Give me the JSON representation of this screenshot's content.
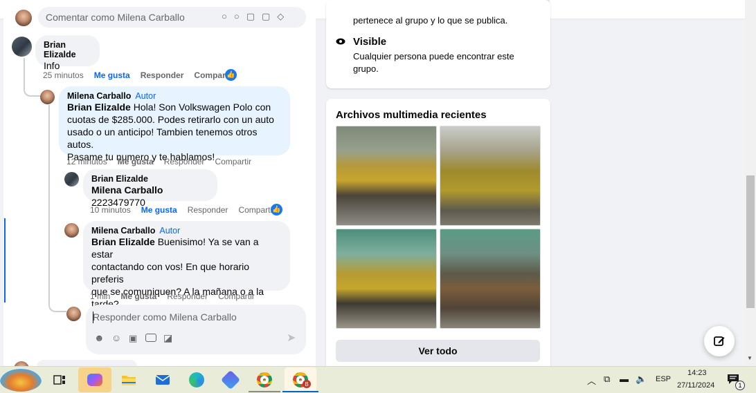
{
  "top": {
    "comment_placeholder": "Comentar como Milena Carballo",
    "about_line": "pertenece al grupo y lo que se publica.",
    "search_icon": "search-icon",
    "more_icon": "more-icon"
  },
  "about": {
    "visible_title": "Visible",
    "visible_desc_1": "Cualquier persona puede encontrar este",
    "visible_desc_2": "grupo."
  },
  "comments": [
    {
      "name": "Brian Elizalde",
      "text": "Info",
      "time": "25 minutos",
      "like": "Me gusta",
      "reply": "Responder",
      "share": "Compartir"
    },
    {
      "name": "Milena Carballo",
      "badge": "Autor",
      "tag": "Brian Elizalde",
      "lines": [
        "Hola! Son Volkswagen Polo con",
        "cuotas de $285.000. Podes retirarlo con un auto",
        "usado o un anticipo! Tambien tenemos otros autos.",
        "Pasame tu numero y te hablamos!"
      ],
      "time": "12 minutos",
      "like": "Me gusta",
      "reply": "Responder",
      "share": "Compartir"
    },
    {
      "name": "Brian Elizalde",
      "tag": "Milena Carballo",
      "text": "2223479770",
      "time": "10 minutos",
      "like": "Me gusta",
      "reply": "Responder",
      "share": "Compartir"
    },
    {
      "name": "Milena Carballo",
      "badge": "Autor",
      "tag": "Brian Elizalde",
      "lines": [
        "Buenisimo! Ya se van a estar",
        "contactando con vos! En que horario preferis",
        "que se comuniquen? A la mañana o a la",
        "tarde?"
      ],
      "time": "1 min",
      "like": "Me gusta",
      "reply": "Responder",
      "share": "Compartir"
    }
  ],
  "reply_box": {
    "placeholder": "Responder como Milena Carballo"
  },
  "media": {
    "title": "Archivos multimedia recientes",
    "see_all": "Ver todo"
  },
  "taskbar": {
    "language": "ESP",
    "time": "14:23",
    "date": "27/11/2024",
    "notification_count": "1",
    "chrome_badge": "B"
  }
}
